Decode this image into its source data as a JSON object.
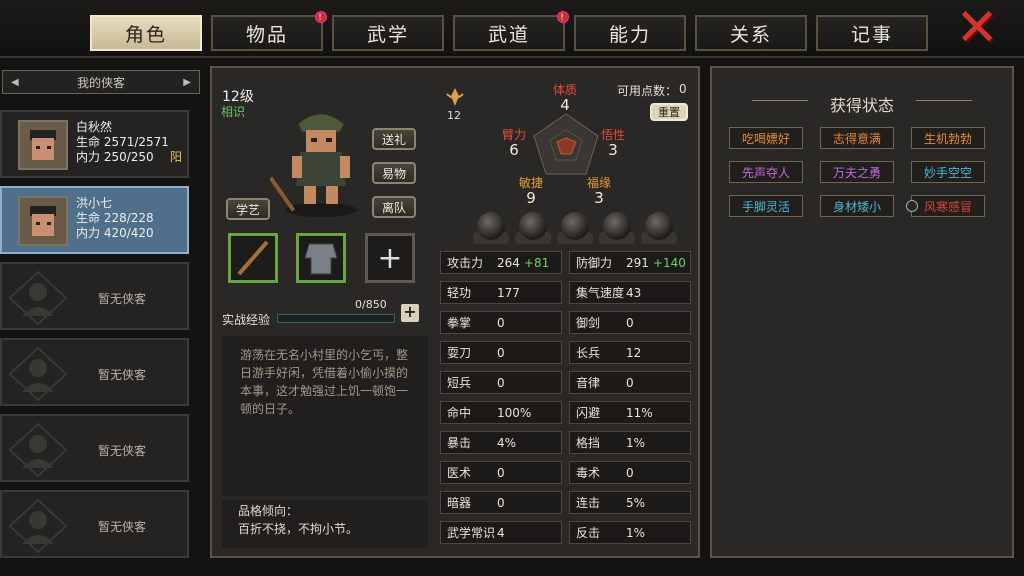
{
  "tabs": [
    {
      "label": "角色",
      "active": true,
      "alert": false
    },
    {
      "label": "物品",
      "active": false,
      "alert": true
    },
    {
      "label": "武学",
      "active": false,
      "alert": false
    },
    {
      "label": "武道",
      "active": false,
      "alert": true
    },
    {
      "label": "能力",
      "active": false,
      "alert": false
    },
    {
      "label": "关系",
      "active": false,
      "alert": false
    },
    {
      "label": "记事",
      "active": false,
      "alert": false
    }
  ],
  "alert_mark": "!",
  "close_icon": "✕",
  "sidebar": {
    "header": "我的侠客",
    "heroes": [
      {
        "name": "白秋然",
        "hp": "生命 2571/2571",
        "mp": "内力 250/250",
        "tag": "阳",
        "selected": false
      },
      {
        "name": "洪小七",
        "hp": "生命 228/228",
        "mp": "内力 420/420",
        "tag": "",
        "selected": true
      }
    ],
    "empty_label": "暂无侠客"
  },
  "character": {
    "level": "12级",
    "relation": "相识",
    "buttons": {
      "gift": "送礼",
      "trade": "易物",
      "leave": "离队",
      "learn": "学艺"
    },
    "exp_label": "实战经验",
    "exp_value": "0/850",
    "exp_fraction": 0.0,
    "exp_plus": "+",
    "add_equip": "+",
    "description": "游荡在无名小村里的小乞丐，整日游手好闲，凭借着小偷小摸的本事，这才勉强过上饥一顿饱一顿的日子。",
    "trait_label": "品格倾向：",
    "trait_value": "百折不挠，不拘小节。"
  },
  "attributes": {
    "rank_value": "12",
    "points_label": "可用点数：",
    "points_value": "0",
    "reset": "重置",
    "tizhi": {
      "label": "体质",
      "value": "4"
    },
    "biili": {
      "label": "臂力",
      "value": "6"
    },
    "wuxing": {
      "label": "悟性",
      "value": "3"
    },
    "minjie": {
      "label": "敏捷",
      "value": "9"
    },
    "fuyuan": {
      "label": "福缘",
      "value": "3"
    }
  },
  "stats": [
    {
      "k": "攻击力",
      "v": "264",
      "b": "+81"
    },
    {
      "k": "防御力",
      "v": "291",
      "b": "+140"
    },
    {
      "k": "轻功",
      "v": "177",
      "b": ""
    },
    {
      "k": "集气速度",
      "v": "43",
      "b": ""
    },
    {
      "k": "拳掌",
      "v": "0",
      "b": ""
    },
    {
      "k": "御剑",
      "v": "0",
      "b": ""
    },
    {
      "k": "耍刀",
      "v": "0",
      "b": ""
    },
    {
      "k": "长兵",
      "v": "12",
      "b": ""
    },
    {
      "k": "短兵",
      "v": "0",
      "b": ""
    },
    {
      "k": "音律",
      "v": "0",
      "b": ""
    },
    {
      "k": "命中",
      "v": "100%",
      "b": ""
    },
    {
      "k": "闪避",
      "v": "11%",
      "b": ""
    },
    {
      "k": "暴击",
      "v": "4%",
      "b": ""
    },
    {
      "k": "格挡",
      "v": "1%",
      "b": ""
    },
    {
      "k": "医术",
      "v": "0",
      "b": ""
    },
    {
      "k": "毒术",
      "v": "0",
      "b": ""
    },
    {
      "k": "暗器",
      "v": "0",
      "b": ""
    },
    {
      "k": "连击",
      "v": "5%",
      "b": ""
    },
    {
      "k": "武学常识",
      "v": "4",
      "b": ""
    },
    {
      "k": "反击",
      "v": "1%",
      "b": ""
    }
  ],
  "status": {
    "title": "获得状态",
    "badges": [
      {
        "label": "吃喝嫖好",
        "color": "#e28a3a"
      },
      {
        "label": "志得意满",
        "color": "#e28a3a"
      },
      {
        "label": "生机勃勃",
        "color": "#e28a3a"
      },
      {
        "label": "先声夺人",
        "color": "#c46be0"
      },
      {
        "label": "万夫之勇",
        "color": "#c46be0"
      },
      {
        "label": "妙手空空",
        "color": "#4fb6d8"
      },
      {
        "label": "手脚灵活",
        "color": "#4fb6d8"
      },
      {
        "label": "身材矮小",
        "color": "#4fb6d8"
      },
      {
        "label": "风寒感冒",
        "color": "#d8443a"
      }
    ]
  }
}
